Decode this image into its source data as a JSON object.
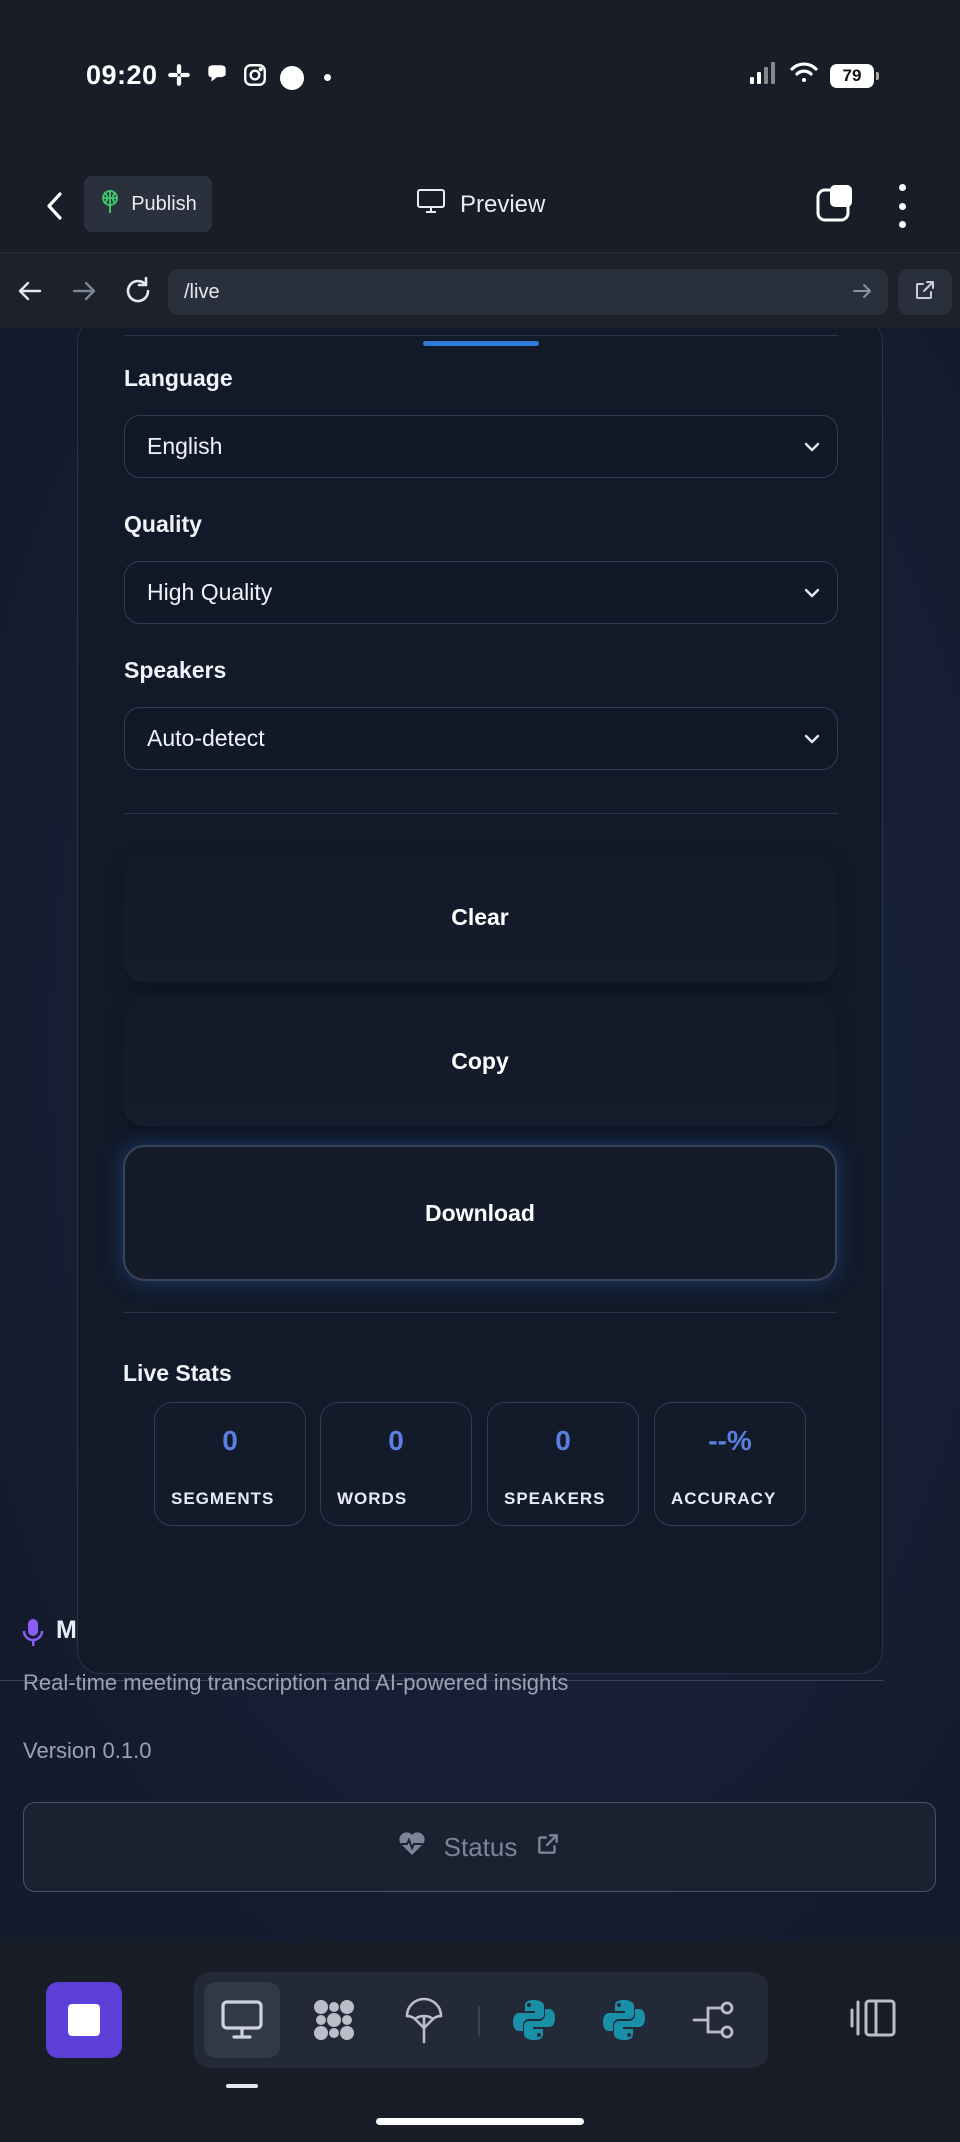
{
  "status_bar": {
    "time": "09:20",
    "battery": "79"
  },
  "toolbar": {
    "publish_label": "Publish",
    "preview_label": "Preview"
  },
  "url_bar": {
    "url": "/live"
  },
  "settings": {
    "language": {
      "label": "Language",
      "value": "English"
    },
    "quality": {
      "label": "Quality",
      "value": "High Quality"
    },
    "speakers": {
      "label": "Speakers",
      "value": "Auto-detect"
    }
  },
  "actions": {
    "clear": "Clear",
    "copy": "Copy",
    "download": "Download"
  },
  "live_stats": {
    "title": "Live Stats",
    "items": [
      {
        "value": "0",
        "label": "SEGMENTS"
      },
      {
        "value": "0",
        "label": "WORDS"
      },
      {
        "value": "0",
        "label": "SPEAKERS"
      },
      {
        "value": "--%",
        "label": "ACCURACY"
      }
    ]
  },
  "footer": {
    "app_name_fragment": "M",
    "tagline": "Real-time meeting transcription and AI-powered insights",
    "version": "Version 0.1.0",
    "status_label": "Status"
  },
  "colors": {
    "accent": "#5b3fd6",
    "stat_value": "#5b7fe0",
    "tab_indicator": "#2d7bd6",
    "python_teal": "#1a8fa8"
  },
  "icons": [
    "slack-icon",
    "chat-icon",
    "instagram-icon",
    "signal-icon",
    "wifi-icon",
    "battery-icon",
    "back-chevron-icon",
    "publish-icon",
    "monitor-icon",
    "tabs-icon",
    "more-vertical-icon",
    "arrow-left-icon",
    "arrow-right-icon",
    "reload-icon",
    "go-arrow-icon",
    "external-link-icon",
    "chevron-down-icon",
    "microphone-icon",
    "heart-pulse-icon",
    "stop-icon",
    "desktop-icon",
    "extensions-icon",
    "deploy-icon",
    "python-icon",
    "workflow-icon",
    "panel-toggle-icon"
  ]
}
